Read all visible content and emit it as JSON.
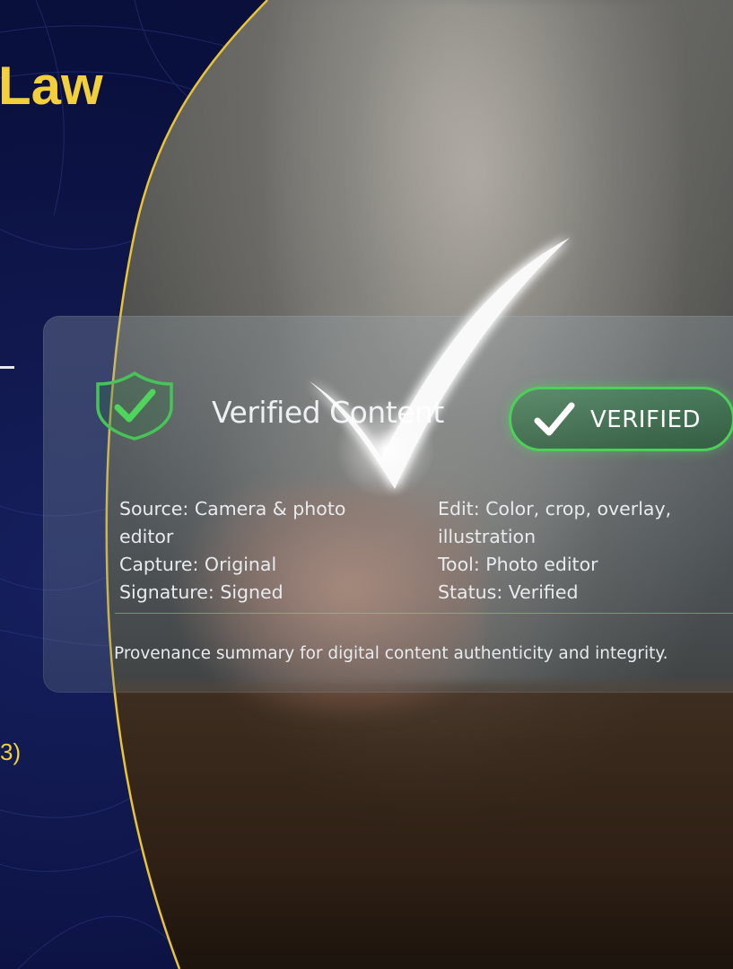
{
  "left_panel": {
    "title_fragment": "Law",
    "bottom_fragment": "3)",
    "colors": {
      "background": "#0b1140",
      "accent": "#f2cf3b"
    }
  },
  "card": {
    "title": "Verified Content",
    "badge_label": "VERIFIED",
    "shield_icon": "shield-check-icon",
    "left_column": [
      "Source: Camera & photo",
      "editor",
      "Capture: Original",
      "Signature: Signed"
    ],
    "right_column": [
      "Edit: Color, crop, overlay,",
      "illustration",
      "Tool: Photo editor",
      "Status: Verified"
    ],
    "summary": "Provenance summary for digital content authenticity and integrity.",
    "colors": {
      "badge_green": "#4cd158",
      "text": "#e8ebee"
    }
  },
  "overlay": {
    "big_check_icon": "glowing-checkmark-icon"
  }
}
